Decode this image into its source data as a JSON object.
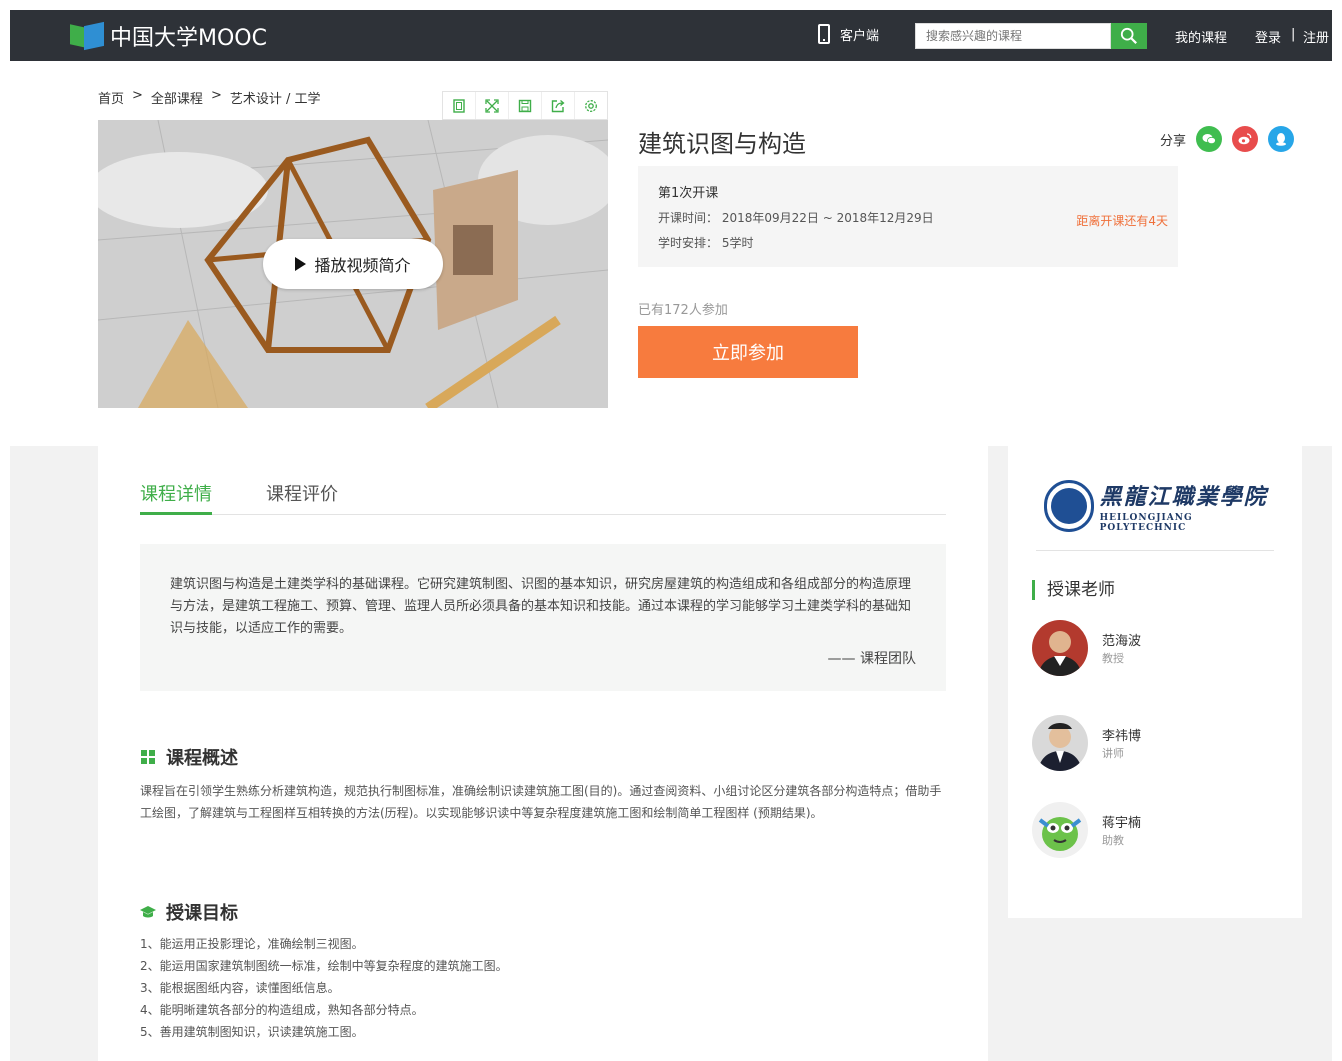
{
  "header": {
    "logo_text": "中国大学MOOC",
    "client_label": "客户端",
    "search_placeholder": "搜索感兴趣的课程",
    "my_courses": "我的课程",
    "login": "登录",
    "divider": "|",
    "register": "注册"
  },
  "breadcrumb": {
    "items": [
      "首页",
      "全部课程",
      "艺术设计 / 工学"
    ],
    "separator": ">"
  },
  "video": {
    "play_label": "播放视频简介"
  },
  "course": {
    "title": "建筑识图与构造",
    "share_label": "分享",
    "term_name": "第1次开课",
    "time_label": "开课时间：",
    "time_value": "2018年09月22日 ~ 2018年12月29日",
    "hours_label": "学时安排：",
    "hours_value": "5学时",
    "countdown": "距离开课还有4天",
    "enrolled": "已有172人参加",
    "join_button": "立即参加"
  },
  "tabs": [
    {
      "label": "课程详情",
      "active": true
    },
    {
      "label": "课程评价",
      "active": false
    }
  ],
  "intro": {
    "text": "建筑识图与构造是土建类学科的基础课程。它研究建筑制图、识图的基本知识，研究房屋建筑的构造组成和各组成部分的构造原理与方法，是建筑工程施工、预算、管理、监理人员所必须具备的基本知识和技能。通过本课程的学习能够学习土建类学科的基础知识与技能，以适应工作的需要。",
    "signature": "—— 课程团队"
  },
  "overview": {
    "heading": "课程概述",
    "text": "课程旨在引领学生熟练分析建筑构造，规范执行制图标准，准确绘制识读建筑施工图(目的)。通过查阅资料、小组讨论区分建筑各部分构造特点；借助手工绘图，了解建筑与工程图样互相转换的方法(历程)。以实现能够识读中等复杂程度建筑施工图和绘制简单工程图样 (预期结果)。"
  },
  "goals": {
    "heading": "授课目标",
    "items": [
      "1、能运用正投影理论，准确绘制三视图。",
      "2、能运用国家建筑制图统一标准，绘制中等复杂程度的建筑施工图。",
      "3、能根据图纸内容，读懂图纸信息。",
      "4、能明晰建筑各部分的构造组成，熟知各部分特点。",
      "5、善用建筑制图知识，识读建筑施工图。"
    ]
  },
  "school": {
    "name_cn": "黑龍江職業學院",
    "name_en": "HEILONGJIANG POLYTECHNIC"
  },
  "teachers": {
    "heading": "授课老师",
    "list": [
      {
        "name": "范海波",
        "title": "教授"
      },
      {
        "name": "李祎博",
        "title": "讲师"
      },
      {
        "name": "蒋宇楠",
        "title": "助教"
      }
    ]
  },
  "colors": {
    "accent_green": "#3fae49",
    "join_orange": "#f77b3e",
    "countdown_orange": "#f0703a",
    "topbar": "#2e3238"
  },
  "icons": {
    "tools": [
      "mini-player-icon",
      "fullscreen-icon",
      "save-icon",
      "share-out-icon",
      "settings-icon"
    ],
    "share": [
      "wechat-icon",
      "weibo-icon",
      "qq-icon"
    ]
  }
}
